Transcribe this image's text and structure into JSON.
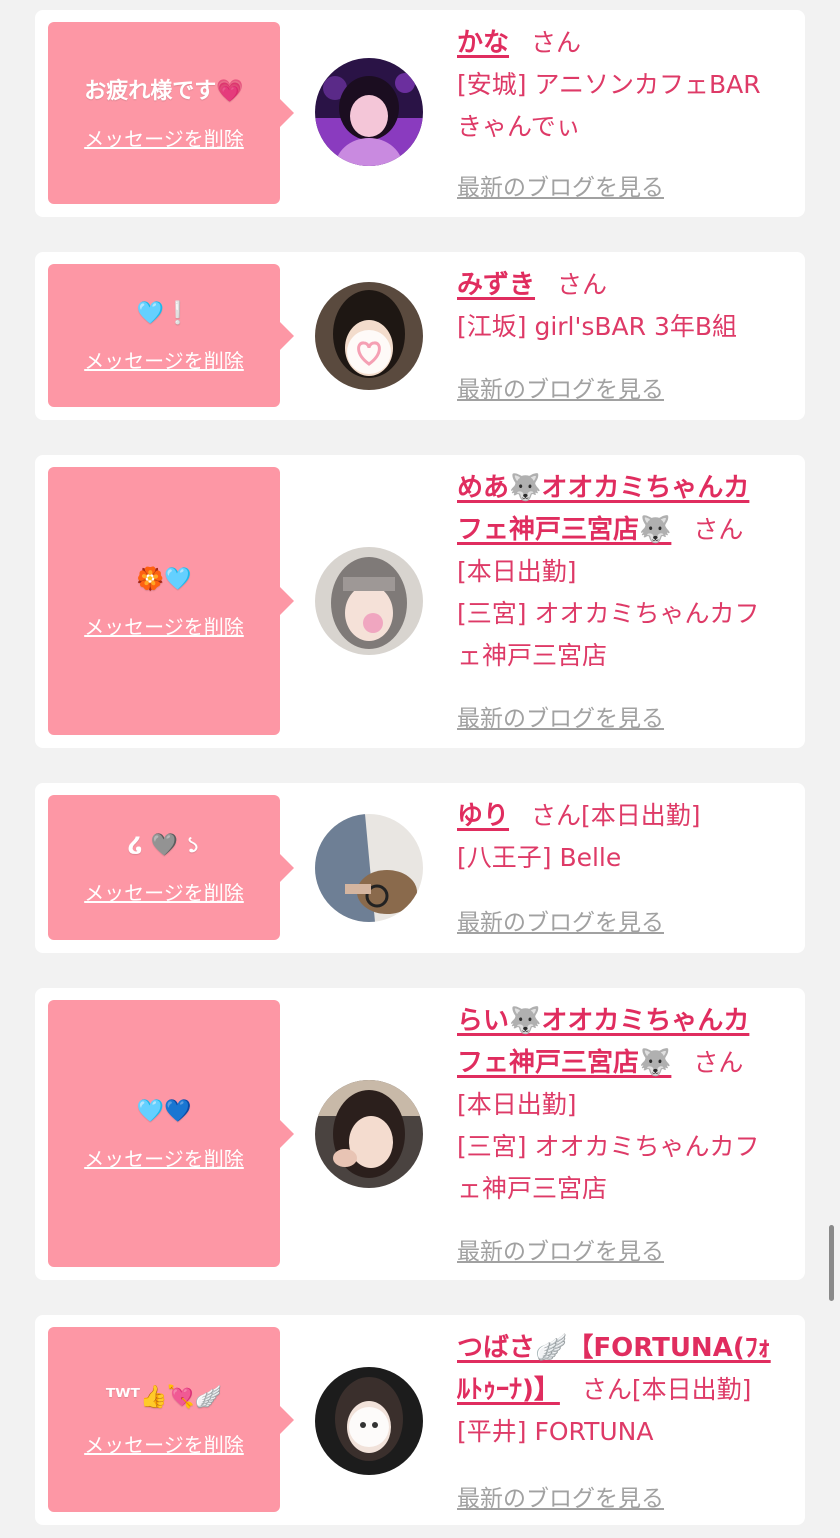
{
  "messages": [
    {
      "message": "お疲れ様です💗",
      "delete_label": "メッセージを削除",
      "name": "かな",
      "honorific": "さん",
      "lines": [
        "[安城] アニソンカフェBAR",
        "きゃんでぃ"
      ],
      "blog_label": "最新のブログを見る"
    },
    {
      "message": "🩵❕",
      "delete_label": "メッセージを削除",
      "name": "みずき",
      "honorific": "さん",
      "lines": [
        "[江坂] girl'sBAR 3年B組"
      ],
      "blog_label": "最新のブログを見る"
    },
    {
      "message": "🏵️🩵",
      "delete_label": "メッセージを削除",
      "name_line1": "めあ🐺オオカミちゃんカ",
      "name_line2": "フェ神戸三宮店🐺",
      "honorific": "さん",
      "lines": [
        "[本日出勤]",
        "[三宮] オオカミちゃんカフ",
        "ェ神戸三宮店"
      ],
      "blog_label": "最新のブログを見る"
    },
    {
      "message": "໒ 🩶 ১",
      "delete_label": "メッセージを削除",
      "name": "ゆり",
      "honorific": "さん",
      "status": "[本日出勤]",
      "lines": [
        "[八王子] Belle"
      ],
      "blog_label": "最新のブログを見る"
    },
    {
      "message": "🩵💙",
      "delete_label": "メッセージを削除",
      "name_line1": "らい🐺オオカミちゃんカ",
      "name_line2": "フェ神戸三宮店🐺",
      "honorific": "さん",
      "lines": [
        "[本日出勤]",
        "[三宮] オオカミちゃんカフ",
        "ェ神戸三宮店"
      ],
      "blog_label": "最新のブログを見る"
    },
    {
      "message": "ᵀᵂᵀ👍💘🪽",
      "delete_label": "メッセージを削除",
      "name_line1": "つばさ🪽【FORTUNA(ﾌｫ",
      "name_line2": "ﾙﾄｩｰﾅ)】",
      "honorific": "さん",
      "status": "[本日出勤]",
      "lines": [
        "[平井] FORTUNA"
      ],
      "blog_label": "最新のブログを見る"
    }
  ],
  "colors": {
    "bubble": "#fd97a5",
    "name": "#e02d5f",
    "text": "#de3a67",
    "blog": "#a1a1a1",
    "background": "#f2f2f2"
  }
}
